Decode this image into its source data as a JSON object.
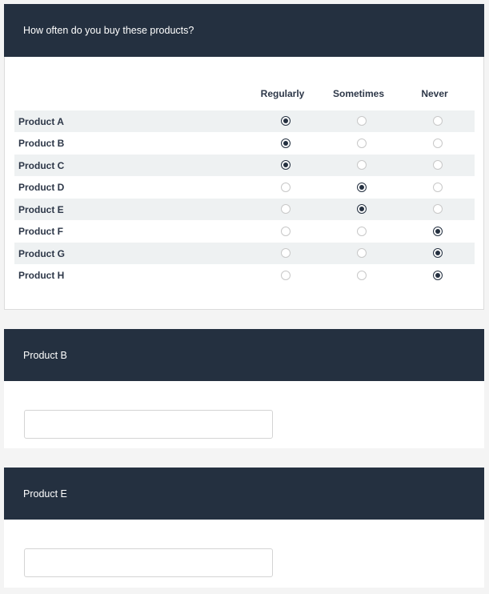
{
  "question": {
    "title": "How often do you buy these products?",
    "columns": [
      "Regularly",
      "Sometimes",
      "Never"
    ],
    "rows": [
      {
        "label": "Product A",
        "selected": "Regularly"
      },
      {
        "label": "Product B",
        "selected": "Regularly"
      },
      {
        "label": "Product C",
        "selected": "Regularly"
      },
      {
        "label": "Product D",
        "selected": "Sometimes"
      },
      {
        "label": "Product E",
        "selected": "Sometimes"
      },
      {
        "label": "Product F",
        "selected": "Never"
      },
      {
        "label": "Product G",
        "selected": "Never"
      },
      {
        "label": "Product H",
        "selected": "Never"
      }
    ]
  },
  "followups": [
    {
      "title": "Product B",
      "value": "",
      "placeholder": ""
    },
    {
      "title": "Product E",
      "value": "",
      "placeholder": ""
    }
  ],
  "colors": {
    "header_bg": "#243040",
    "row_shade": "#eef1f2",
    "page_bg": "#f4f4f4"
  }
}
